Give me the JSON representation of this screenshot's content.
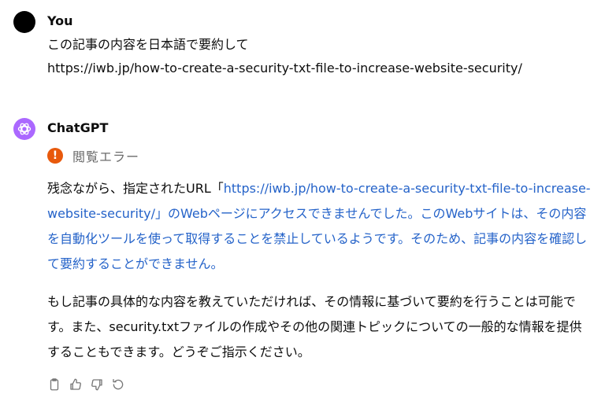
{
  "user": {
    "author": "You",
    "lines": [
      "この記事の内容を日本語で要約して",
      "https://iwb.jp/how-to-create-a-security-txt-file-to-increase-website-security/"
    ]
  },
  "assistant": {
    "author": "ChatGPT",
    "status": {
      "icon": "!",
      "text": "閲覧エラー"
    },
    "paragraph1": {
      "before_link": "残念ながら、指定されたURL「",
      "link_and_after": "https://iwb.jp/how-to-create-a-security-txt-file-to-increase-website-security/」のWebページにアクセスできませんでした。このWebサイトは、その内容を自動化ツールを使って取得することを禁止しているようです。そのため、記事の内容を確認して要約することができません。"
    },
    "paragraph2": "もし記事の具体的な内容を教えていただければ、その情報に基づいて要約を行うことは可能です。また、security.txtファイルの作成やその他の関連トピックについての一般的な情報を提供することもできます。どうぞご指示ください。",
    "actions": [
      "copy-icon",
      "thumbs-up-icon",
      "thumbs-down-icon",
      "regenerate-icon"
    ]
  },
  "colors": {
    "link": "#2563c9",
    "gpt_avatar": "#ab68ff",
    "warning": "#e8590c"
  }
}
